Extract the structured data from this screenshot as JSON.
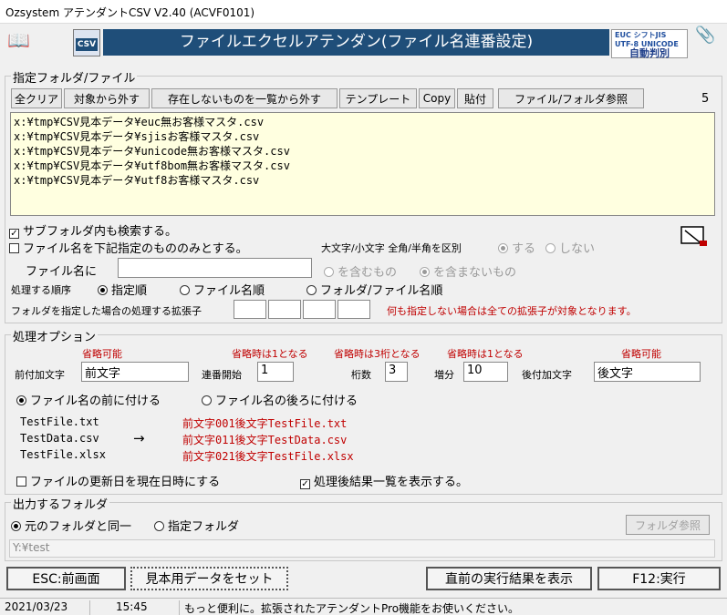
{
  "window": {
    "title": "Ozsystem アテンダントCSV V2.40 (ACVF0101)"
  },
  "header": {
    "banner": "ファイルエクセルアテンダン(ファイル名連番設定)",
    "csv_icon_text": "CSV",
    "logo": {
      "line1": "EUC  シフトJIS",
      "line2": "UTF-8 UNICODE",
      "line3": "自動判別"
    }
  },
  "folder_section": {
    "title": "指定フォルダ/ファイル",
    "buttons": [
      "全クリア",
      "対象から外す",
      "存在しないものを一覧から外す",
      "テンプレート",
      "Copy",
      "貼付",
      "ファイル/フォルダ参照"
    ],
    "count": "5",
    "files": [
      "x:¥tmp¥CSV見本データ¥euc無お客様マスタ.csv",
      "x:¥tmp¥CSV見本データ¥sjisお客様マスタ.csv",
      "x:¥tmp¥CSV見本データ¥unicode無お客様マスタ.csv",
      "x:¥tmp¥CSV見本データ¥utf8bom無お客様マスタ.csv",
      "x:¥tmp¥CSV見本データ¥utf8お客様マスタ.csv"
    ],
    "subfolder_label": "サブフォルダ内も検索する。",
    "subfolder_checked": true,
    "filename_only_label": "ファイル名を下記指定のもののみとする。",
    "filename_only_checked": false,
    "case_label": "大文字/小文字 全角/半角を区別",
    "case_yes": "する",
    "case_no": "しない",
    "filename_label": "ファイル名に",
    "filename_value": "",
    "contains_label": "を含むもの",
    "not_contains_label": "を含まないもの",
    "order_label": "処理する順序",
    "order_options": [
      "指定順",
      "ファイル名順",
      "フォルダ/ファイル名順"
    ],
    "order_selected": "指定順",
    "ext_label": "フォルダを指定した場合の処理する拡張子",
    "ext_note": "何も指定しない場合は全ての拡張子が対象となります。"
  },
  "options_section": {
    "title": "処理オプション",
    "prefix": {
      "hint": "省略可能",
      "label": "前付加文字",
      "value": "前文字"
    },
    "start": {
      "hint": "省略時は1となる",
      "label": "連番開始",
      "value": "1"
    },
    "digits": {
      "hint": "省略時は3桁となる",
      "label": "桁数",
      "value": "3"
    },
    "step": {
      "hint": "省略時は1となる",
      "label": "増分",
      "value": "10"
    },
    "suffix": {
      "hint": "省略可能",
      "label": "後付加文字",
      "value": "後文字"
    },
    "position_before": "ファイル名の前に付ける",
    "position_after": "ファイル名の後ろに付ける",
    "position_selected": "before",
    "examples": [
      {
        "src": "TestFile.txt",
        "dst": "前文字001後文字TestFile.txt"
      },
      {
        "src": "TestData.csv",
        "dst": "前文字011後文字TestData.csv"
      },
      {
        "src": "TestFile.xlsx",
        "dst": "前文字021後文字TestFile.xlsx"
      }
    ],
    "arrow": "→",
    "update_date_label": "ファイルの更新日を現在日時にする",
    "update_date_checked": false,
    "show_result_label": "処理後結果一覧を表示する。",
    "show_result_checked": true
  },
  "output_section": {
    "title": "出力するフォルダ",
    "same_folder": "元のフォルダと同一",
    "specified_folder": "指定フォルダ",
    "selected": "same",
    "browse_button": "フォルダ参照",
    "path": "Y:¥test"
  },
  "footer_buttons": {
    "back": "ESC:前画面",
    "sample": "見本用データをセット",
    "last_result": "直前の実行結果を表示",
    "execute": "F12:実行"
  },
  "statusbar": {
    "date": "2021/03/23",
    "time": "15:45",
    "message": "もっと便利に。拡張されたアテンダントPro機能をお使いください。"
  },
  "colors": {
    "banner_bg": "#1f4e79",
    "list_bg": "#ffffe0",
    "hint_red": "#c00000"
  }
}
